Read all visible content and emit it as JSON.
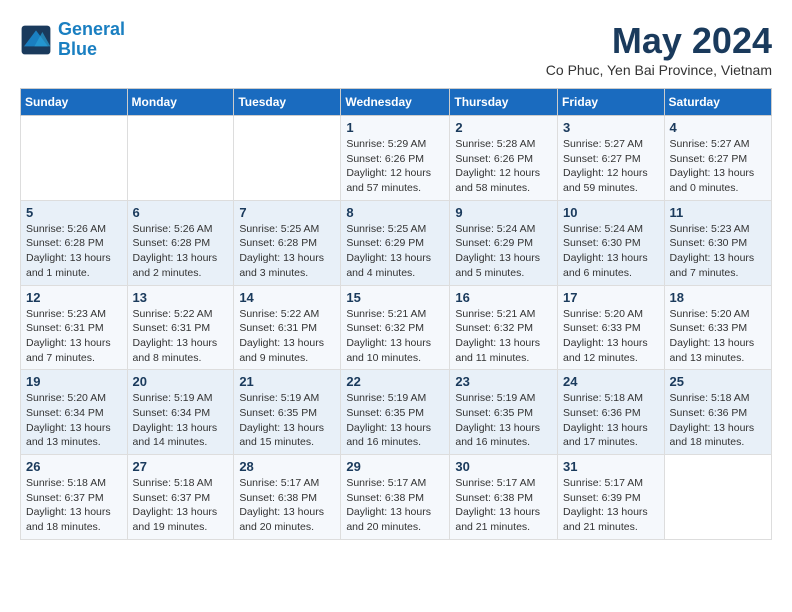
{
  "header": {
    "logo_line1": "General",
    "logo_line2": "Blue",
    "title": "May 2024",
    "subtitle": "Co Phuc, Yen Bai Province, Vietnam"
  },
  "days_of_week": [
    "Sunday",
    "Monday",
    "Tuesday",
    "Wednesday",
    "Thursday",
    "Friday",
    "Saturday"
  ],
  "weeks": [
    [
      {
        "day": "",
        "info": ""
      },
      {
        "day": "",
        "info": ""
      },
      {
        "day": "",
        "info": ""
      },
      {
        "day": "1",
        "info": "Sunrise: 5:29 AM\nSunset: 6:26 PM\nDaylight: 12 hours\nand 57 minutes."
      },
      {
        "day": "2",
        "info": "Sunrise: 5:28 AM\nSunset: 6:26 PM\nDaylight: 12 hours\nand 58 minutes."
      },
      {
        "day": "3",
        "info": "Sunrise: 5:27 AM\nSunset: 6:27 PM\nDaylight: 12 hours\nand 59 minutes."
      },
      {
        "day": "4",
        "info": "Sunrise: 5:27 AM\nSunset: 6:27 PM\nDaylight: 13 hours\nand 0 minutes."
      }
    ],
    [
      {
        "day": "5",
        "info": "Sunrise: 5:26 AM\nSunset: 6:28 PM\nDaylight: 13 hours\nand 1 minute."
      },
      {
        "day": "6",
        "info": "Sunrise: 5:26 AM\nSunset: 6:28 PM\nDaylight: 13 hours\nand 2 minutes."
      },
      {
        "day": "7",
        "info": "Sunrise: 5:25 AM\nSunset: 6:28 PM\nDaylight: 13 hours\nand 3 minutes."
      },
      {
        "day": "8",
        "info": "Sunrise: 5:25 AM\nSunset: 6:29 PM\nDaylight: 13 hours\nand 4 minutes."
      },
      {
        "day": "9",
        "info": "Sunrise: 5:24 AM\nSunset: 6:29 PM\nDaylight: 13 hours\nand 5 minutes."
      },
      {
        "day": "10",
        "info": "Sunrise: 5:24 AM\nSunset: 6:30 PM\nDaylight: 13 hours\nand 6 minutes."
      },
      {
        "day": "11",
        "info": "Sunrise: 5:23 AM\nSunset: 6:30 PM\nDaylight: 13 hours\nand 7 minutes."
      }
    ],
    [
      {
        "day": "12",
        "info": "Sunrise: 5:23 AM\nSunset: 6:31 PM\nDaylight: 13 hours\nand 7 minutes."
      },
      {
        "day": "13",
        "info": "Sunrise: 5:22 AM\nSunset: 6:31 PM\nDaylight: 13 hours\nand 8 minutes."
      },
      {
        "day": "14",
        "info": "Sunrise: 5:22 AM\nSunset: 6:31 PM\nDaylight: 13 hours\nand 9 minutes."
      },
      {
        "day": "15",
        "info": "Sunrise: 5:21 AM\nSunset: 6:32 PM\nDaylight: 13 hours\nand 10 minutes."
      },
      {
        "day": "16",
        "info": "Sunrise: 5:21 AM\nSunset: 6:32 PM\nDaylight: 13 hours\nand 11 minutes."
      },
      {
        "day": "17",
        "info": "Sunrise: 5:20 AM\nSunset: 6:33 PM\nDaylight: 13 hours\nand 12 minutes."
      },
      {
        "day": "18",
        "info": "Sunrise: 5:20 AM\nSunset: 6:33 PM\nDaylight: 13 hours\nand 13 minutes."
      }
    ],
    [
      {
        "day": "19",
        "info": "Sunrise: 5:20 AM\nSunset: 6:34 PM\nDaylight: 13 hours\nand 13 minutes."
      },
      {
        "day": "20",
        "info": "Sunrise: 5:19 AM\nSunset: 6:34 PM\nDaylight: 13 hours\nand 14 minutes."
      },
      {
        "day": "21",
        "info": "Sunrise: 5:19 AM\nSunset: 6:35 PM\nDaylight: 13 hours\nand 15 minutes."
      },
      {
        "day": "22",
        "info": "Sunrise: 5:19 AM\nSunset: 6:35 PM\nDaylight: 13 hours\nand 16 minutes."
      },
      {
        "day": "23",
        "info": "Sunrise: 5:19 AM\nSunset: 6:35 PM\nDaylight: 13 hours\nand 16 minutes."
      },
      {
        "day": "24",
        "info": "Sunrise: 5:18 AM\nSunset: 6:36 PM\nDaylight: 13 hours\nand 17 minutes."
      },
      {
        "day": "25",
        "info": "Sunrise: 5:18 AM\nSunset: 6:36 PM\nDaylight: 13 hours\nand 18 minutes."
      }
    ],
    [
      {
        "day": "26",
        "info": "Sunrise: 5:18 AM\nSunset: 6:37 PM\nDaylight: 13 hours\nand 18 minutes."
      },
      {
        "day": "27",
        "info": "Sunrise: 5:18 AM\nSunset: 6:37 PM\nDaylight: 13 hours\nand 19 minutes."
      },
      {
        "day": "28",
        "info": "Sunrise: 5:17 AM\nSunset: 6:38 PM\nDaylight: 13 hours\nand 20 minutes."
      },
      {
        "day": "29",
        "info": "Sunrise: 5:17 AM\nSunset: 6:38 PM\nDaylight: 13 hours\nand 20 minutes."
      },
      {
        "day": "30",
        "info": "Sunrise: 5:17 AM\nSunset: 6:38 PM\nDaylight: 13 hours\nand 21 minutes."
      },
      {
        "day": "31",
        "info": "Sunrise: 5:17 AM\nSunset: 6:39 PM\nDaylight: 13 hours\nand 21 minutes."
      },
      {
        "day": "",
        "info": ""
      }
    ]
  ]
}
